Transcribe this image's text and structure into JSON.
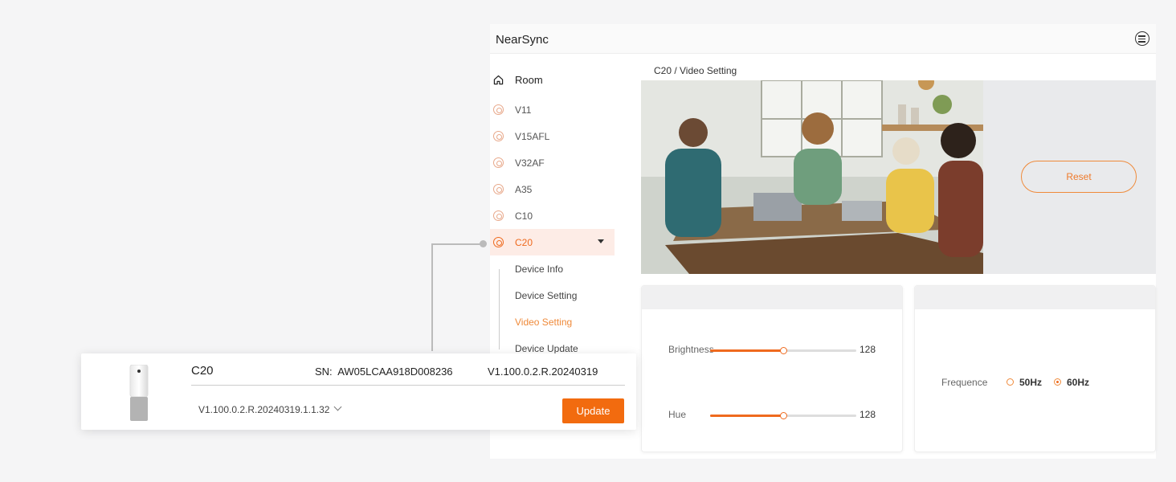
{
  "app": {
    "title": "NearSync"
  },
  "sidebar": {
    "room_label": "Room",
    "devices": [
      {
        "label": "V11"
      },
      {
        "label": "V15AFL"
      },
      {
        "label": "V32AF"
      },
      {
        "label": "A35"
      },
      {
        "label": "C10"
      },
      {
        "label": "C20"
      }
    ],
    "submenu": [
      {
        "label": "Device Info"
      },
      {
        "label": "Device Setting"
      },
      {
        "label": "Video Setting"
      },
      {
        "label": "Device Update"
      }
    ]
  },
  "breadcrumb": "C20 / Video Setting",
  "preview": {
    "reset_label": "Reset"
  },
  "image_settings": {
    "brightness": {
      "label": "Brightness",
      "value": "128",
      "fraction": 0.5
    },
    "hue": {
      "label": "Hue",
      "value": "128",
      "fraction": 0.5
    }
  },
  "frequency": {
    "label": "Frequence",
    "options": [
      "50Hz",
      "60Hz"
    ],
    "selected": "60Hz"
  },
  "update_popup": {
    "device_name": "C20",
    "sn_label": "SN:",
    "sn": "AW05LCAA918D008236",
    "current_version": "V1.100.0.2.R.20240319",
    "selected_version": "V1.100.0.2.R.20240319.1.1.32",
    "update_label": "Update"
  },
  "colors": {
    "accent": "#ef6a1e",
    "accent_light": "#fdece6"
  }
}
